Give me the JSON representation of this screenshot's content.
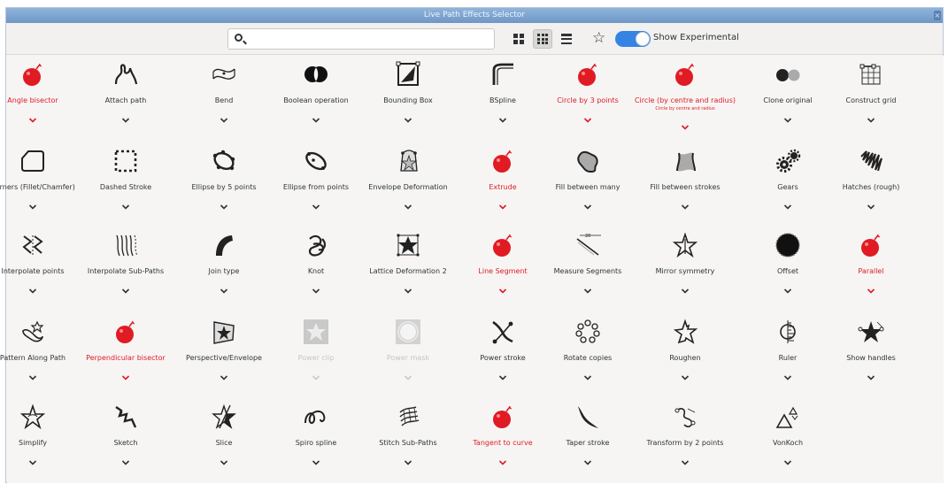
{
  "window": {
    "title": "Live Path Effects Selector",
    "close_glyph": "×"
  },
  "toolbar": {
    "search": {
      "value": "",
      "placeholder": ""
    },
    "show_experimental_label": "Show Experimental",
    "show_experimental_on": true,
    "accent_color": "#3584e4"
  },
  "colors": {
    "highlight": "#e01b24",
    "text": "#2e3436",
    "disabled": "#c5c5c5"
  },
  "effects": [
    {
      "label": "Angle bisector",
      "icon": "bomb-icon",
      "red": true
    },
    {
      "label": "Attach path",
      "icon": "attach-path-icon"
    },
    {
      "label": "Bend",
      "icon": "bend-icon"
    },
    {
      "label": "Boolean operation",
      "icon": "boolean-icon"
    },
    {
      "label": "Bounding Box",
      "icon": "bounding-box-icon"
    },
    {
      "label": "BSpline",
      "icon": "bspline-icon"
    },
    {
      "label": "Circle by 3 points",
      "icon": "bomb-icon",
      "red": true
    },
    {
      "label": "Circle (by centre and radius)",
      "sublabel": "Circle by centre and radius",
      "icon": "bomb-icon",
      "red": true
    },
    {
      "label": "Clone original",
      "icon": "clone-original-icon"
    },
    {
      "label": "Construct grid",
      "icon": "construct-grid-icon"
    },
    {
      "label": "Corners (Fillet/Chamfer)",
      "icon": "corners-icon"
    },
    {
      "label": "Dashed Stroke",
      "icon": "dashed-stroke-icon"
    },
    {
      "label": "Ellipse by 5 points",
      "icon": "ellipse-5-points-icon"
    },
    {
      "label": "Ellipse from points",
      "icon": "ellipse-from-points-icon"
    },
    {
      "label": "Envelope Deformation",
      "icon": "envelope-deformation-icon"
    },
    {
      "label": "Extrude",
      "icon": "bomb-icon",
      "red": true
    },
    {
      "label": "Fill between many",
      "icon": "fill-between-many-icon"
    },
    {
      "label": "Fill between strokes",
      "icon": "fill-between-strokes-icon"
    },
    {
      "label": "Gears",
      "icon": "gears-icon"
    },
    {
      "label": "Hatches (rough)",
      "icon": "hatches-icon"
    },
    {
      "label": "Interpolate points",
      "icon": "interpolate-points-icon"
    },
    {
      "label": "Interpolate Sub-Paths",
      "icon": "interpolate-subpaths-icon"
    },
    {
      "label": "Join type",
      "icon": "join-type-icon"
    },
    {
      "label": "Knot",
      "icon": "knot-icon"
    },
    {
      "label": "Lattice Deformation 2",
      "icon": "lattice-deformation-icon"
    },
    {
      "label": "Line Segment",
      "icon": "bomb-icon",
      "red": true
    },
    {
      "label": "Measure Segments",
      "icon": "measure-segments-icon"
    },
    {
      "label": "Mirror symmetry",
      "icon": "mirror-symmetry-icon"
    },
    {
      "label": "Offset",
      "icon": "offset-icon"
    },
    {
      "label": "Parallel",
      "icon": "bomb-icon",
      "red": true
    },
    {
      "label": "Pattern Along Path",
      "icon": "pattern-along-path-icon"
    },
    {
      "label": "Perpendicular bisector",
      "icon": "bomb-icon",
      "red": true
    },
    {
      "label": "Perspective/Envelope",
      "icon": "perspective-envelope-icon"
    },
    {
      "label": "Power clip",
      "icon": "power-clip-icon",
      "disabled": true
    },
    {
      "label": "Power mask",
      "icon": "power-mask-icon",
      "disabled": true
    },
    {
      "label": "Power stroke",
      "icon": "power-stroke-icon"
    },
    {
      "label": "Rotate copies",
      "icon": "rotate-copies-icon"
    },
    {
      "label": "Roughen",
      "icon": "roughen-icon"
    },
    {
      "label": "Ruler",
      "icon": "ruler-icon"
    },
    {
      "label": "Show handles",
      "icon": "show-handles-icon"
    },
    {
      "label": "Simplify",
      "icon": "simplify-icon"
    },
    {
      "label": "Sketch",
      "icon": "sketch-icon"
    },
    {
      "label": "Slice",
      "icon": "slice-icon"
    },
    {
      "label": "Spiro spline",
      "icon": "spiro-spline-icon"
    },
    {
      "label": "Stitch Sub-Paths",
      "icon": "stitch-subpaths-icon"
    },
    {
      "label": "Tangent to curve",
      "icon": "bomb-icon",
      "red": true
    },
    {
      "label": "Taper stroke",
      "icon": "taper-stroke-icon"
    },
    {
      "label": "Transform by 2 points",
      "icon": "transform-2-points-icon"
    },
    {
      "label": "VonKoch",
      "icon": "vonkoch-icon"
    }
  ]
}
